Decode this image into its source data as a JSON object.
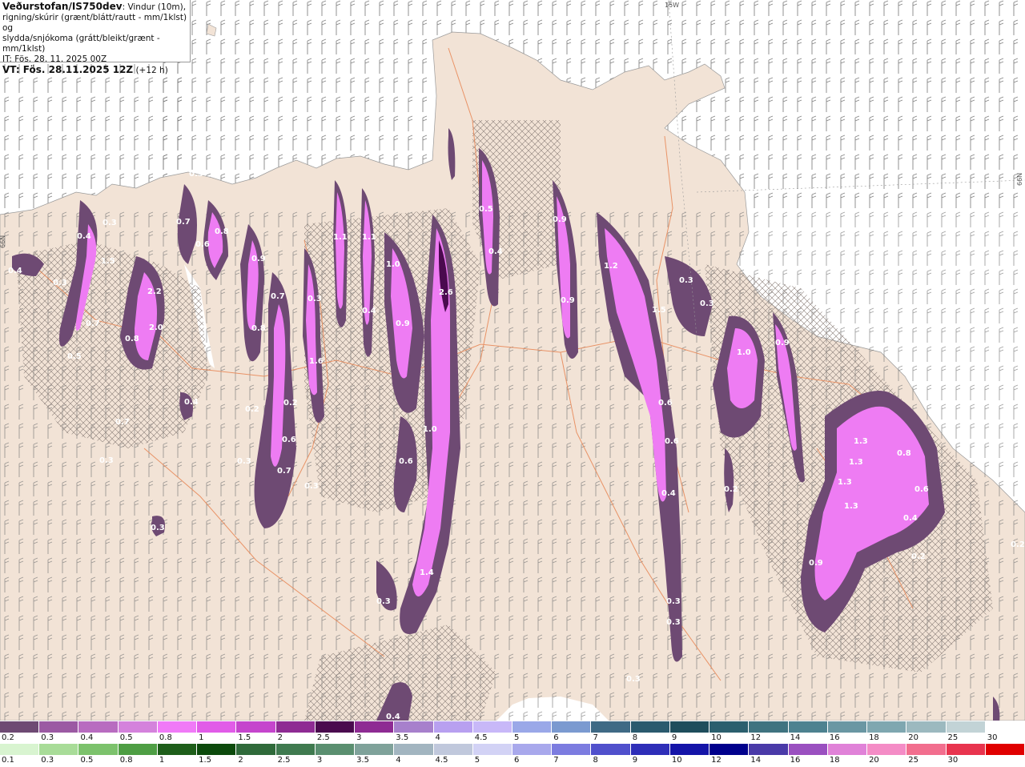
{
  "header": {
    "org": "Veðurstofan/IS750dev",
    "desc1": ": Vindur (10m),",
    "desc2": "rigning/skúrir (grænt/blátt/rautt - mm/1klst) og",
    "desc3": "slydda/snjókoma (grátt/bleikt/grænt - mm/1klst)",
    "it": "IT: Fös. 28. 11. 2025 00Z",
    "vt_label": "VT: Fös. 28.11.2025 12Z",
    "vt_offset": " (+12 h)"
  },
  "graticule": {
    "top": "15W",
    "left": "66N",
    "right": "66N"
  },
  "colors": {
    "sea": "#ffffff",
    "land": "#f2e3d6",
    "roads": "#e88a5a",
    "precip_light": "#6e4a73",
    "precip_mid": "#b85cc2",
    "precip_strong": "#ee7cf3",
    "precip_max": "#4a0a4e"
  },
  "map_values": [
    "0.4",
    "0.4",
    "0.3",
    "0.3",
    "1.5",
    "2.2",
    "2.0",
    "0.7",
    "0.8",
    "0.5",
    "0.7",
    "0.6",
    "0.8",
    "0.9",
    "0.7",
    "0.8",
    "0.3",
    "1.6",
    "1.1",
    "1.1",
    "1.0",
    "0.4",
    "0.9",
    "2.6",
    "0.5",
    "0.4",
    "0.9",
    "0.9",
    "1.2",
    "1.5",
    "0.3",
    "0.3",
    "1.0",
    "0.9",
    "0.4",
    "0.2",
    "0.7",
    "0.2",
    "0.3",
    "0.3",
    "0.6",
    "0.7",
    "0.3",
    "1.0",
    "0.6",
    "0.4",
    "0.6",
    "0.6",
    "1.3",
    "1.3",
    "1.3",
    "1.3",
    "0.8",
    "0.6",
    "0.4",
    "0.2",
    "0.9",
    "0.2",
    "0.3",
    "1.4",
    "0.3",
    "0.3",
    "0.3",
    "0.4",
    "0.3",
    "0.2",
    "0.3"
  ],
  "legend_snow": {
    "labels": [
      "0.2",
      "0.3",
      "0.4",
      "0.5",
      "0.8",
      "1",
      "1.5",
      "2",
      "2.5",
      "3",
      "3.5",
      "4",
      "4.5",
      "5",
      "6",
      "7",
      "8",
      "9",
      "10",
      "12",
      "14",
      "16",
      "18",
      "20",
      "25",
      "30"
    ],
    "colors": [
      "#6e4a73",
      "#9b5aa3",
      "#b86cc0",
      "#d482dc",
      "#f07af7",
      "#e15ce8",
      "#c545cd",
      "#8e2b93",
      "#4a0a4e",
      "#8e2b93",
      "#a780cc",
      "#b8a0f0",
      "#c8b8f8",
      "#9aa8e8",
      "#7b9ad0",
      "#3f6a85",
      "#2a5a6e",
      "#1e4d5c",
      "#2b5f6e",
      "#3f7380",
      "#4d8290",
      "#6a97a3",
      "#7fa7b0",
      "#9cb9bf",
      "#c2d3d6",
      "#ffffff"
    ]
  },
  "legend_rain": {
    "labels": [
      "0.1",
      "0.3",
      "0.5",
      "0.8",
      "1",
      "1.5",
      "2",
      "2.5",
      "3",
      "3.5",
      "4",
      "4.5",
      "5",
      "6",
      "7",
      "8",
      "9",
      "10",
      "12",
      "14",
      "16",
      "18",
      "20",
      "25",
      "30"
    ],
    "colors": [
      "#d8f4d0",
      "#a8dc98",
      "#7cc26c",
      "#4e9e44",
      "#1e5e1a",
      "#0c4a0c",
      "#2f6a3a",
      "#3f7a4f",
      "#5a8f70",
      "#7fa29a",
      "#a2b5c0",
      "#c0c8dc",
      "#d2d2f5",
      "#a8a8ec",
      "#7c7ce0",
      "#5050cc",
      "#2e2eb8",
      "#1414a8",
      "#00008c",
      "#4a3aa8",
      "#9a50c0",
      "#e082d8",
      "#f48cc6",
      "#f26e8e",
      "#e8344e",
      "#e00000"
    ]
  }
}
